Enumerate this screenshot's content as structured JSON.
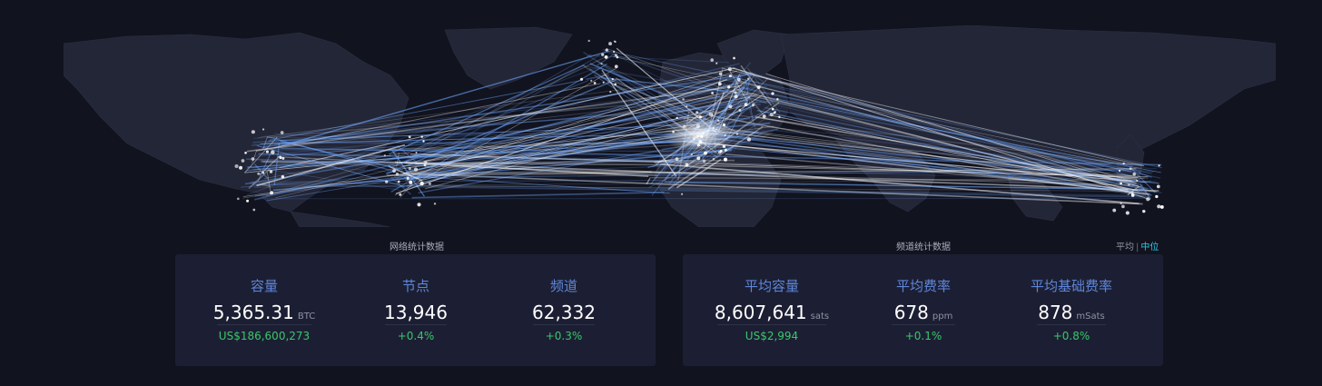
{
  "sections": {
    "network_title": "网络统计数据",
    "channel_title": "频道统计数据"
  },
  "toggle": {
    "average_label": "平均",
    "separator": "|",
    "median_label": "中位"
  },
  "network_stats": [
    {
      "label": "容量",
      "value": "5,365.31",
      "unit": "BTC",
      "change": "US$186,600,273"
    },
    {
      "label": "节点",
      "value": "13,946",
      "unit": "",
      "change": "+0.4%"
    },
    {
      "label": "频道",
      "value": "62,332",
      "unit": "",
      "change": "+0.3%"
    }
  ],
  "channel_stats": [
    {
      "label": "平均容量",
      "value": "8,607,641",
      "unit": "sats",
      "change": "US$2,994"
    },
    {
      "label": "平均费率",
      "value": "678",
      "unit": "ppm",
      "change": "+0.1%"
    },
    {
      "label": "平均基础费率",
      "value": "878",
      "unit": "mSats",
      "change": "+0.8%"
    }
  ],
  "colors": {
    "background": "#11131f",
    "card": "#1c1f33",
    "label_blue": "#5f86d9",
    "change_green": "#3bc66b",
    "toggle_active": "#2fc8e8",
    "map_land": "#232636",
    "channel_line": "#6fa8ff"
  }
}
